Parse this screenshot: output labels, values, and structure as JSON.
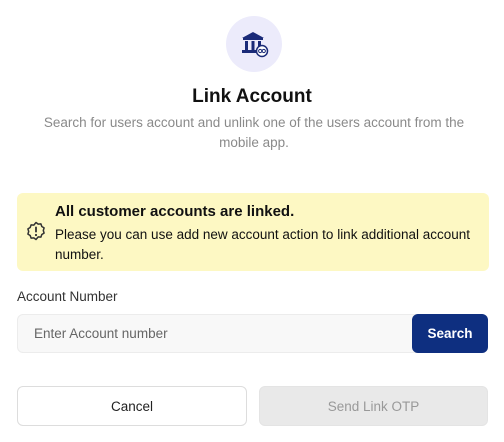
{
  "header": {
    "icon": "bank-link-icon",
    "title": "Link Account",
    "subtitle": "Search for users account and unlink one of the users account from the mobile app."
  },
  "alert": {
    "icon": "alert-badge-icon",
    "title": "All customer accounts are linked.",
    "body": "Please you can use add new account action to link additional account number.",
    "background": "#fdf8c3"
  },
  "form": {
    "label": "Account Number",
    "value": "",
    "placeholder": "Enter Account number",
    "search_label": "Search"
  },
  "actions": {
    "cancel_label": "Cancel",
    "send_otp_label": "Send Link OTP"
  },
  "colors": {
    "primary": "#0e2f80",
    "icon_bg": "#ecebfb"
  }
}
